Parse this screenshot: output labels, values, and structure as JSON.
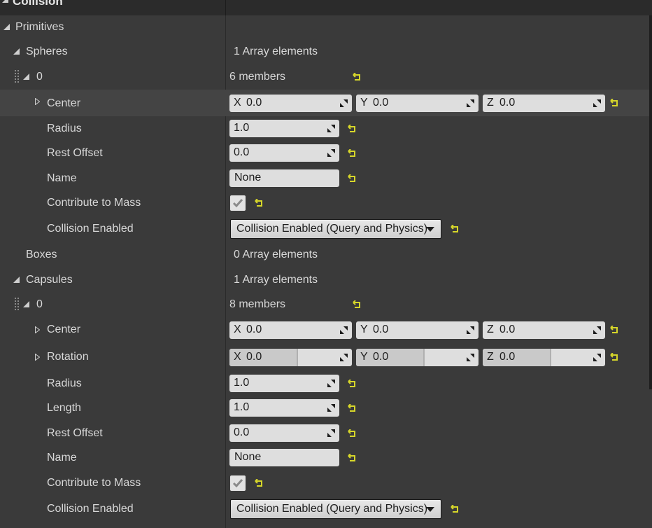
{
  "header": {
    "title": "Collision"
  },
  "tree": {
    "primitives": "Primitives",
    "spheres": {
      "label": "Spheres",
      "count": "1 Array elements"
    },
    "sphere0": {
      "index": "0",
      "members": "6 members",
      "center": {
        "label": "Center",
        "x_axis": "X",
        "x": "0.0",
        "y_axis": "Y",
        "y": "0.0",
        "z_axis": "Z",
        "z": "0.0"
      },
      "radius": {
        "label": "Radius",
        "value": "1.0"
      },
      "rest_offset": {
        "label": "Rest Offset",
        "value": "0.0"
      },
      "name": {
        "label": "Name",
        "value": "None"
      },
      "contribute_to_mass": {
        "label": "Contribute to Mass",
        "checked": true
      },
      "collision_enabled": {
        "label": "Collision Enabled",
        "value": "Collision Enabled (Query and Physics)"
      }
    },
    "boxes": {
      "label": "Boxes",
      "count": "0 Array elements"
    },
    "capsules": {
      "label": "Capsules",
      "count": "1 Array elements"
    },
    "capsule0": {
      "index": "0",
      "members": "8 members",
      "center": {
        "label": "Center",
        "x_axis": "X",
        "x": "0.0",
        "y_axis": "Y",
        "y": "0.0",
        "z_axis": "Z",
        "z": "0.0"
      },
      "rotation": {
        "label": "Rotation",
        "x_axis": "X",
        "x": "0.0",
        "y_axis": "Y",
        "y": "0.0",
        "z_axis": "Z",
        "z": "0.0"
      },
      "radius": {
        "label": "Radius",
        "value": "1.0"
      },
      "length": {
        "label": "Length",
        "value": "1.0"
      },
      "rest_offset": {
        "label": "Rest Offset",
        "value": "0.0"
      },
      "name": {
        "label": "Name",
        "value": "None"
      },
      "contribute_to_mass": {
        "label": "Contribute to Mass",
        "checked": true
      },
      "collision_enabled": {
        "label": "Collision Enabled",
        "value": "Collision Enabled (Query and Physics)"
      }
    }
  },
  "colors": {
    "reset_arrow": "#d6d62a",
    "panel_bg": "#3a3a3a",
    "header_bg": "#2b2b2b",
    "field_bg": "#dedede"
  },
  "icons": {
    "reset": "reset-to-default-icon",
    "spinner": "drag-spinner-icon",
    "expand": "expand-triangle-icon",
    "collapse": "collapse-triangle-icon"
  }
}
